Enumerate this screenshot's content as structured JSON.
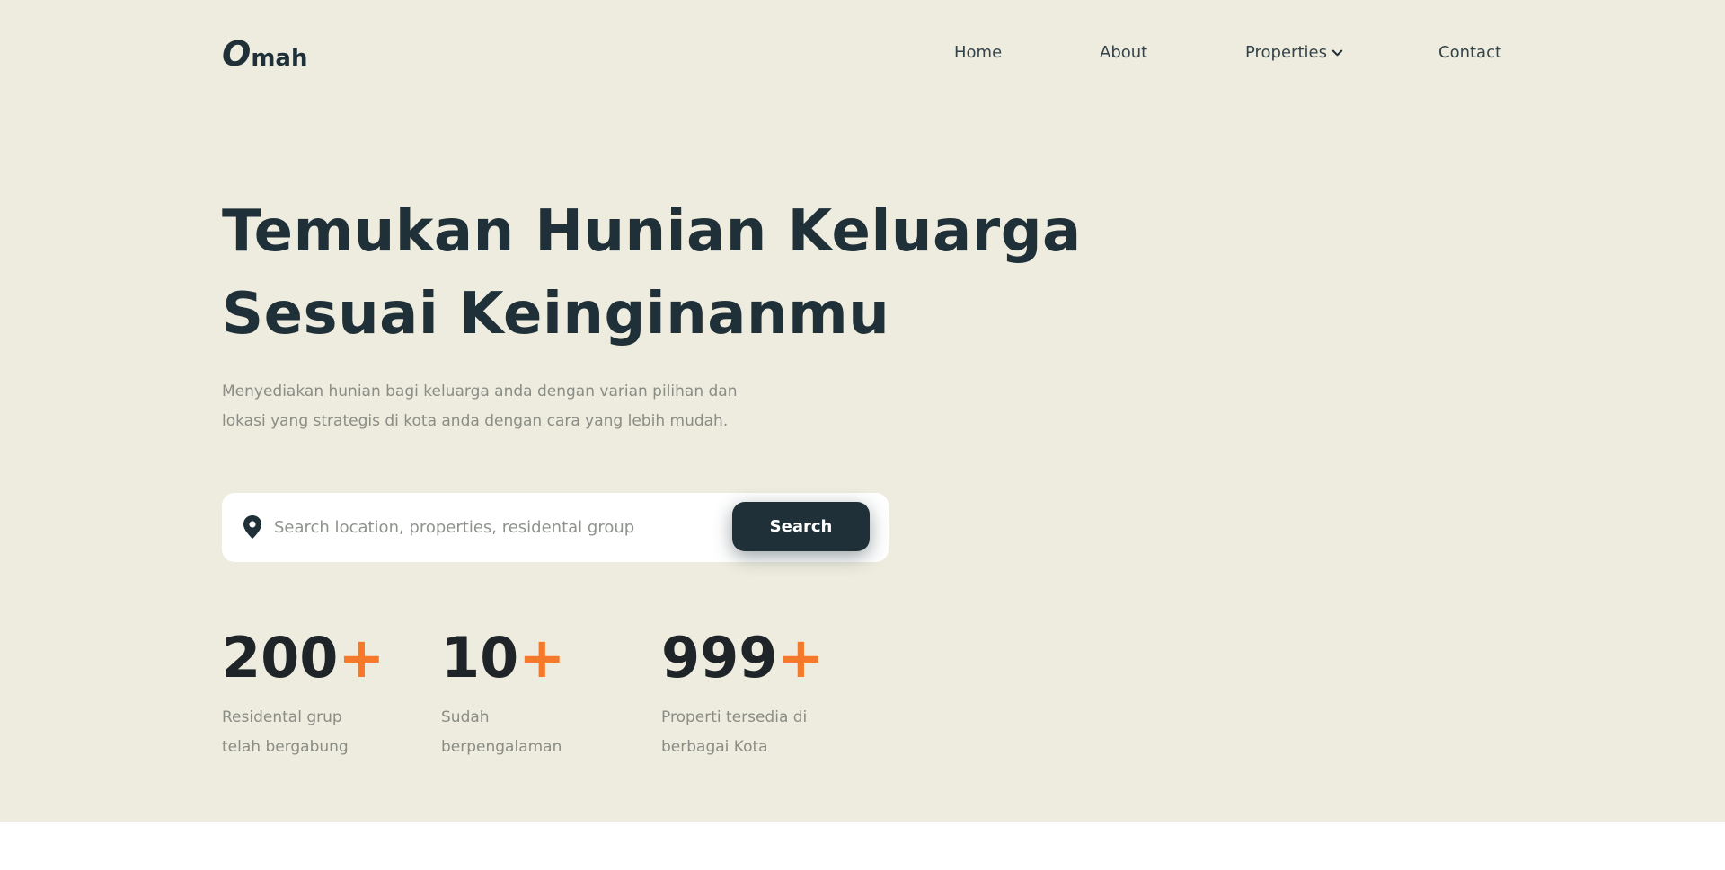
{
  "brand": {
    "logo_mark": "O",
    "logo_text": "mah"
  },
  "nav": {
    "home": "Home",
    "about": "About",
    "properties": "Properties",
    "contact": "Contact"
  },
  "hero": {
    "headline_line1": "Temukan Hunian Keluarga",
    "headline_line2": "Sesuai Keinginanmu",
    "subtext_line1": "Menyediakan hunian bagi keluarga anda dengan varian pilihan dan",
    "subtext_line2": "lokasi yang strategis di kota anda dengan cara yang lebih mudah."
  },
  "search": {
    "placeholder": "Search location, properties, residental group",
    "button_label": "Search"
  },
  "stats": [
    {
      "number": "200",
      "plus": "+",
      "label_line1": "Residental grup",
      "label_line2": "telah bergabung"
    },
    {
      "number": "10",
      "plus": "+",
      "label_line1": "Sudah",
      "label_line2": "berpengalaman"
    },
    {
      "number": "999",
      "plus": "+",
      "label_line1": "Properti tersedia di",
      "label_line2": "berbagai Kota"
    }
  ],
  "colors": {
    "hero_bg": "#eeecde",
    "primary_dark": "#1f3038",
    "accent_orange": "#f5792a",
    "muted_text": "#8a8d85"
  },
  "icons": {
    "location": "map-pin-icon",
    "dropdown": "chevron-down-icon"
  }
}
